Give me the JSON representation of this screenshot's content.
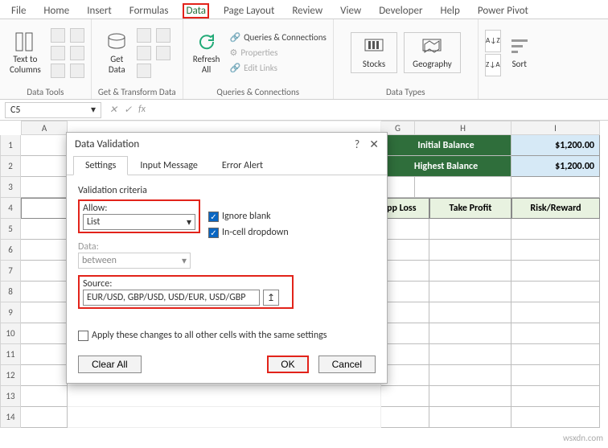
{
  "tabs": {
    "file": "File",
    "home": "Home",
    "insert": "Insert",
    "formulas": "Formulas",
    "data": "Data",
    "page_layout": "Page Layout",
    "review": "Review",
    "view": "View",
    "developer": "Developer",
    "help": "Help",
    "power_pivot": "Power Pivot"
  },
  "ribbon": {
    "text_to_columns": "Text to\nColumns",
    "data_tools": "Data Tools",
    "get_data": "Get\nData",
    "get_transform": "Get & Transform Data",
    "refresh_all": "Refresh\nAll",
    "queries_connections_cmd": "Queries & Connections",
    "properties": "Properties",
    "edit_links": "Edit Links",
    "queries_group": "Queries & Connections",
    "stocks": "Stocks",
    "geography": "Geography",
    "data_types": "Data Types",
    "sort": "Sort"
  },
  "formula_bar": {
    "cell_ref": "C5",
    "fx": "fx"
  },
  "columns": {
    "a": "A",
    "g": "G",
    "h": "H",
    "i": "I"
  },
  "rows": [
    "1",
    "2",
    "3",
    "4",
    "5",
    "6",
    "7",
    "8",
    "9",
    "10",
    "11",
    "12",
    "13",
    "14"
  ],
  "sheet": {
    "initial_balance_label": "Initial Balance",
    "initial_balance_value": "$1,200.00",
    "highest_balance_label": "Highest Balance",
    "highest_balance_value": "$1,200.00",
    "col_stop_loss": "pp Loss",
    "col_take_profit": "Take Profit",
    "col_risk_reward": "Risk/Reward"
  },
  "dialog": {
    "title": "Data Validation",
    "tab_settings": "Settings",
    "tab_input_message": "Input Message",
    "tab_error_alert": "Error Alert",
    "validation_criteria": "Validation criteria",
    "allow_label": "Allow:",
    "allow_value": "List",
    "data_label": "Data:",
    "data_value": "between",
    "ignore_blank": "Ignore blank",
    "incell_dropdown": "In-cell dropdown",
    "source_label": "Source:",
    "source_value": "EUR/USD, GBP/USD, USD/EUR, USD/GBP",
    "apply_all": "Apply these changes to all other cells with the same settings",
    "clear_all": "Clear All",
    "ok": "OK",
    "cancel": "Cancel",
    "help": "?",
    "close": "✕"
  },
  "watermark": "wsxdn.com"
}
